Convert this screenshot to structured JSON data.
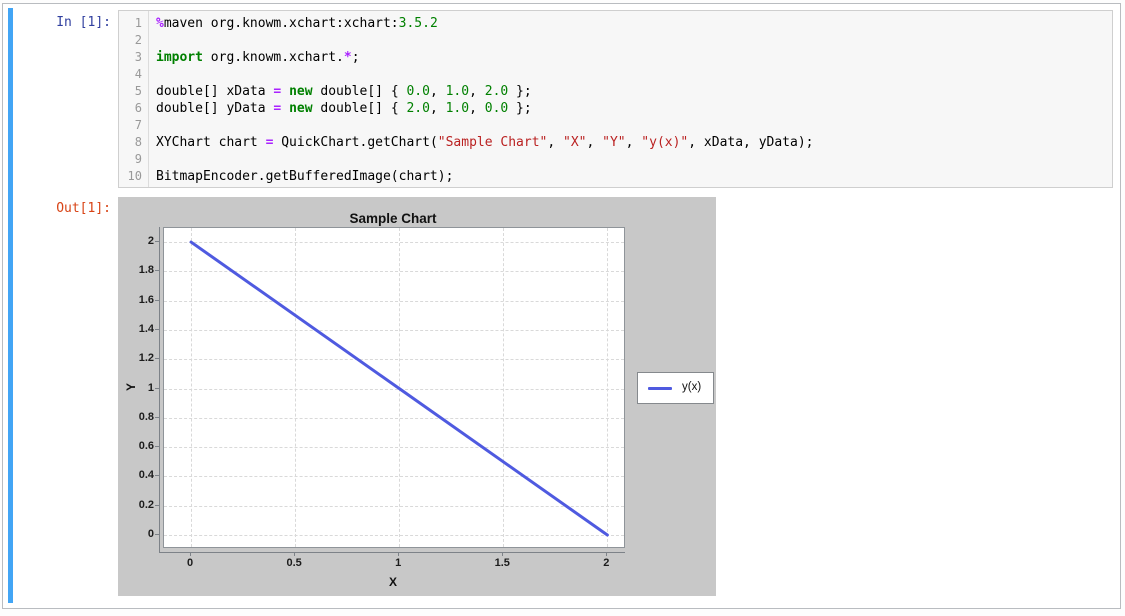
{
  "notebook": {
    "cell": {
      "input_prompt": "In [1]:",
      "output_prompt": "Out[1]:",
      "line_numbers": [
        "1",
        "2",
        "3",
        "4",
        "5",
        "6",
        "7",
        "8",
        "9",
        "10"
      ],
      "code_lines": [
        [
          {
            "t": "%",
            "c": "op"
          },
          {
            "t": "maven org.knowm.xchart:xchart:",
            "c": "pl"
          },
          {
            "t": "3.5.2",
            "c": "num"
          }
        ],
        [],
        [
          {
            "t": "import",
            "c": "kw"
          },
          {
            "t": " org.knowm.xchart.",
            "c": "pl"
          },
          {
            "t": "*",
            "c": "op"
          },
          {
            "t": ";",
            "c": "pl"
          }
        ],
        [],
        [
          {
            "t": "double[] xData ",
            "c": "pl"
          },
          {
            "t": "=",
            "c": "op"
          },
          {
            "t": " ",
            "c": "pl"
          },
          {
            "t": "new",
            "c": "kw"
          },
          {
            "t": " double[] { ",
            "c": "pl"
          },
          {
            "t": "0.0",
            "c": "num"
          },
          {
            "t": ", ",
            "c": "pl"
          },
          {
            "t": "1.0",
            "c": "num"
          },
          {
            "t": ", ",
            "c": "pl"
          },
          {
            "t": "2.0",
            "c": "num"
          },
          {
            "t": " };",
            "c": "pl"
          }
        ],
        [
          {
            "t": "double[] yData ",
            "c": "pl"
          },
          {
            "t": "=",
            "c": "op"
          },
          {
            "t": " ",
            "c": "pl"
          },
          {
            "t": "new",
            "c": "kw"
          },
          {
            "t": " double[] { ",
            "c": "pl"
          },
          {
            "t": "2.0",
            "c": "num"
          },
          {
            "t": ", ",
            "c": "pl"
          },
          {
            "t": "1.0",
            "c": "num"
          },
          {
            "t": ", ",
            "c": "pl"
          },
          {
            "t": "0.0",
            "c": "num"
          },
          {
            "t": " };",
            "c": "pl"
          }
        ],
        [],
        [
          {
            "t": "XYChart chart ",
            "c": "pl"
          },
          {
            "t": "=",
            "c": "op"
          },
          {
            "t": " QuickChart.getChart(",
            "c": "pl"
          },
          {
            "t": "\"Sample Chart\"",
            "c": "str"
          },
          {
            "t": ", ",
            "c": "pl"
          },
          {
            "t": "\"X\"",
            "c": "str"
          },
          {
            "t": ", ",
            "c": "pl"
          },
          {
            "t": "\"Y\"",
            "c": "str"
          },
          {
            "t": ", ",
            "c": "pl"
          },
          {
            "t": "\"y(x)\"",
            "c": "str"
          },
          {
            "t": ", xData, yData);",
            "c": "pl"
          }
        ],
        [],
        [
          {
            "t": "BitmapEncoder.getBufferedImage(chart);",
            "c": "pl"
          }
        ]
      ]
    }
  },
  "colors": {
    "selection_bar": "#42a5f5",
    "input_prompt": "#303f9f",
    "output_prompt": "#d84315",
    "input_bg": "#f7f7f7",
    "keyword_green": "#008000",
    "string_red": "#ba2121",
    "operator_purple": "#aa22ff",
    "chart_bg": "#c8c8c8",
    "series_blue": "#4f5ae0"
  },
  "chart_data": {
    "type": "line",
    "title": "Sample Chart",
    "xlabel": "X",
    "ylabel": "Y",
    "series": [
      {
        "name": "y(x)",
        "x": [
          0.0,
          1.0,
          2.0
        ],
        "y": [
          2.0,
          1.0,
          0.0
        ],
        "color": "#4f5ae0"
      }
    ],
    "x_ticks": [
      0,
      0.5,
      1,
      1.5,
      2
    ],
    "x_tick_labels": [
      "0",
      "0.5",
      "1",
      "1.5",
      "2"
    ],
    "y_ticks": [
      0,
      0.2,
      0.4,
      0.6,
      0.8,
      1,
      1.2,
      1.4,
      1.6,
      1.8,
      2
    ],
    "y_tick_labels": [
      "0",
      "0.2",
      "0.4",
      "0.6",
      "0.8",
      "1",
      "1.2",
      "1.4",
      "1.6",
      "1.8",
      "2"
    ],
    "xlim": [
      -0.13,
      2.08
    ],
    "ylim": [
      -0.082,
      2.096
    ],
    "grid": true,
    "grid_style": "dashed",
    "legend_position": "outside-right",
    "background": "#c8c8c8",
    "plot_background": "#ffffff"
  }
}
